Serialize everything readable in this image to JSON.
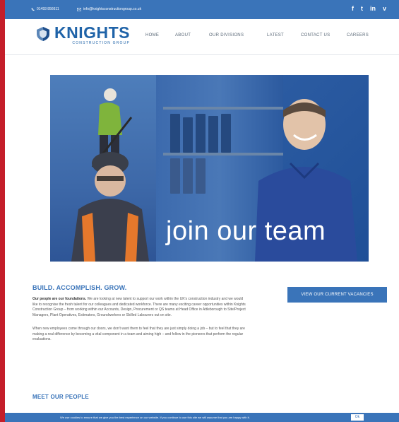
{
  "topbar": {
    "phone": "01493 856611",
    "email": "info@knightsconstructiongroup.co.uk",
    "social": [
      {
        "icon": "facebook-icon",
        "glyph": "f"
      },
      {
        "icon": "twitter-icon",
        "glyph": "t"
      },
      {
        "icon": "linkedin-icon",
        "glyph": "in"
      },
      {
        "icon": "vimeo-icon",
        "glyph": "v"
      }
    ]
  },
  "logo": {
    "name": "KNIGHTS",
    "subtitle": "CONSTRUCTION GROUP"
  },
  "nav": {
    "items": [
      "HOME",
      "ABOUT",
      "OUR DIVISIONS",
      "LATEST",
      "CONTACT US",
      "CAREERS"
    ]
  },
  "hero": {
    "caption": "join our team"
  },
  "content": {
    "heading": "BUILD. ACCOMPLISH. GROW.",
    "paragraph1_bold": "Our people are our foundations.",
    "paragraph1": " We are looking at new talent to support our work within the UK's construction industry and we would like to recognise the fresh talent for our colleagues and dedicated workforce. There are many exciting career opportunities within Knights Construction Group – from working within our Accounts, Design, Procurement or QS teams at Head Office in Attleborough to Site/Project Managers, Plant Operatives, Estimators, Groundworkers or Skilled Labourers out on site.",
    "paragraph2": "When new employees come through our doors, we don't want them to feel that they are just simply doing a job – but to feel that they are making a real difference by becoming a vital component in a team and aiming high – and follow in the pioneers that perform the regular evaluations.",
    "cta_label": "VIEW OUR CURRENT VACANCIES",
    "meet_heading": "MEET OUR PEOPLE"
  },
  "cookie": {
    "message": "We use cookies to ensure that we give you the best experience on our website. If you continue to use this site we will assume that you are happy with it.",
    "ok_label": "Ok"
  },
  "colors": {
    "brand_blue": "#3a74b9",
    "logo_blue": "#1f63a8",
    "frame_red": "#c41e2a"
  }
}
